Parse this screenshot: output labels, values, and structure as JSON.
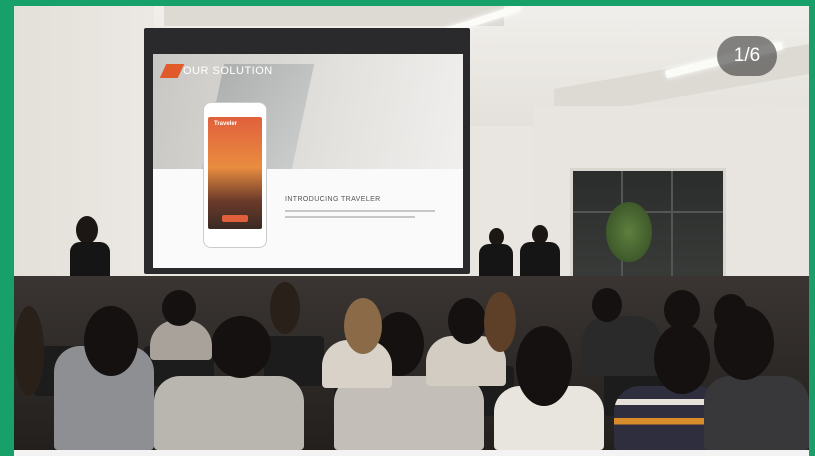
{
  "viewer": {
    "image_counter": "1/6"
  },
  "photo": {
    "slide": {
      "heading": "OUR SOLUTION",
      "subheading": "INTRODUCING TRAVELER",
      "app_name": "Traveler"
    }
  },
  "colors": {
    "frame_accent": "#17a06a",
    "slide_accent": "#e05a2a"
  }
}
